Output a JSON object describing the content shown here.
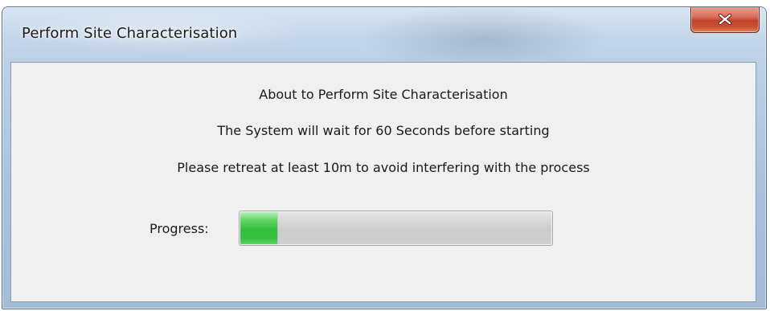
{
  "window": {
    "title": "Perform Site Characterisation",
    "close_icon": "close-icon"
  },
  "dialog": {
    "line1": "About to Perform Site Characterisation",
    "line2": "The System will wait for 60 Seconds before starting",
    "line3": "Please retreat at least 10m to avoid interfering with the process",
    "progress_label": "Progress:",
    "progress_fraction": 0.12
  },
  "colors": {
    "close_button": "#c8472e",
    "progress_fill": "#33c13e",
    "client_background": "#f0f0f0"
  }
}
